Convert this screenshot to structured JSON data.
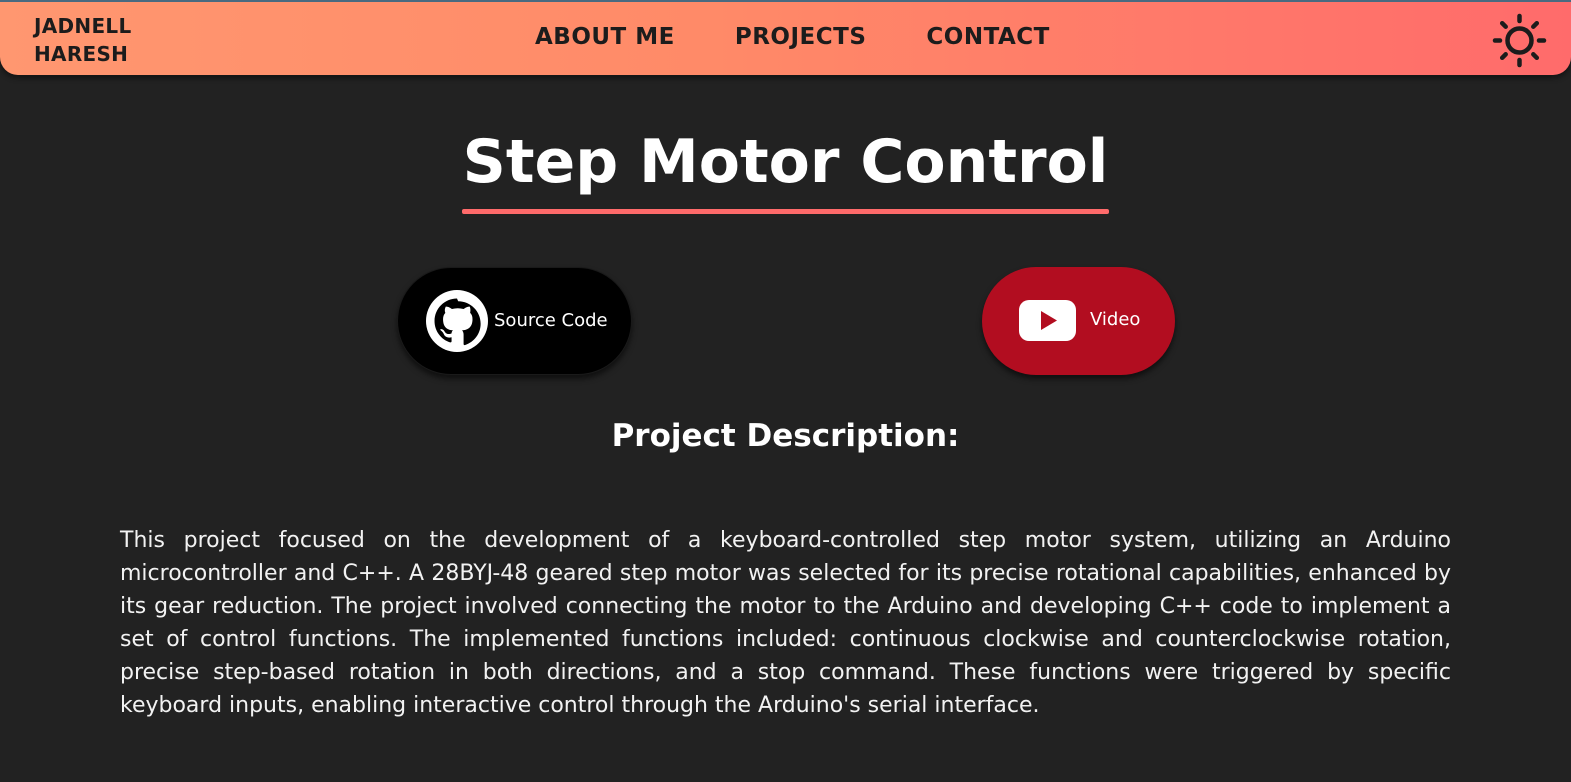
{
  "nav": {
    "brand_line1": "JADNELL",
    "brand_line2": "HARESH",
    "links": [
      {
        "label": "ABOUT ME"
      },
      {
        "label": "PROJECTS"
      },
      {
        "label": "CONTACT"
      }
    ],
    "theme_icon": "sun-icon",
    "gradient_start": "#ff9770",
    "gradient_end": "#ff6b6b"
  },
  "main": {
    "title": "Step Motor Control",
    "accent_color": "#ff6b6b",
    "buttons": {
      "source": {
        "label": "Source Code",
        "icon": "github-icon",
        "color": "#000000"
      },
      "video": {
        "label": "Video",
        "icon": "youtube-icon",
        "color": "#b20d20"
      }
    },
    "description_heading": "Project Description:",
    "description": "This project focused on the development of a keyboard-controlled step motor system, utilizing an Arduino microcontroller and C++. A 28BYJ-48 geared step motor was selected for its precise rotational capabilities, enhanced by its gear reduction. The project involved connecting the motor to the Arduino and developing C++ code to implement a set of control functions. The implemented functions included: continuous clockwise and counterclockwise rotation, precise step-based rotation in both directions, and a stop command. These functions were triggered by specific keyboard inputs, enabling interactive control through the Arduino's serial interface."
  }
}
